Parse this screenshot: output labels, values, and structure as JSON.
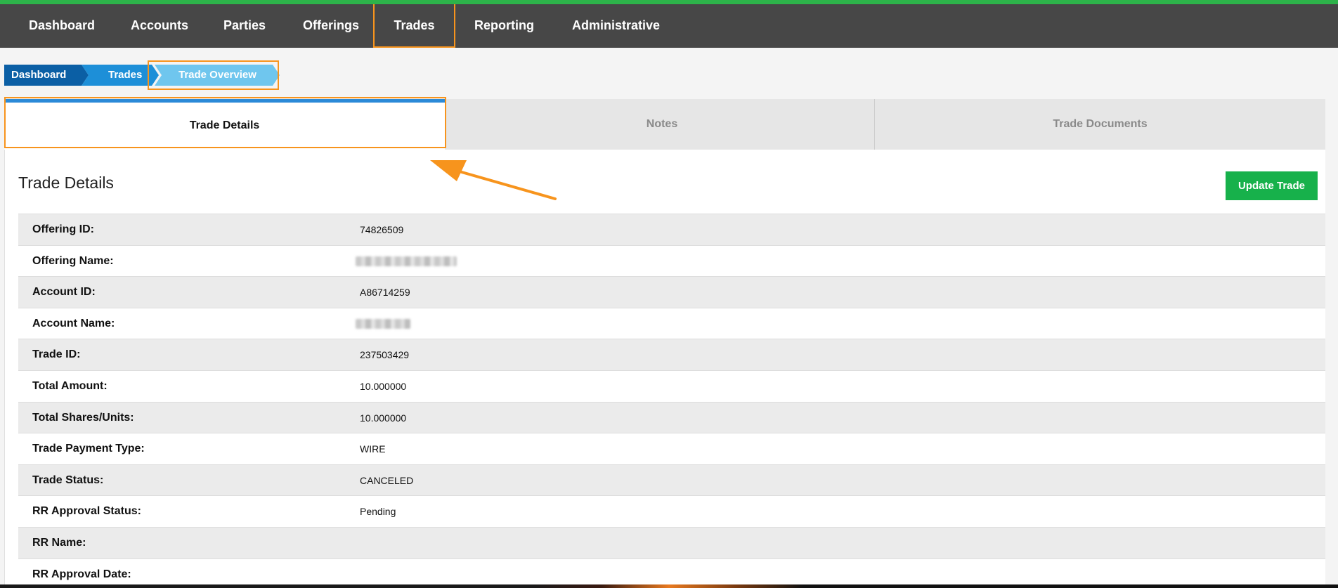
{
  "topnav": {
    "items": [
      "Dashboard",
      "Accounts",
      "Parties",
      "Offerings",
      "Trades",
      "Reporting",
      "Administrative"
    ],
    "active": "Trades"
  },
  "breadcrumb": [
    "Dashboard",
    "Trades",
    "Trade Overview"
  ],
  "tabs": [
    "Trade Details",
    "Notes",
    "Trade Documents"
  ],
  "section": {
    "title": "Trade Details",
    "update_button": "Update Trade"
  },
  "details": [
    {
      "label": "Offering ID:",
      "value": "74826509"
    },
    {
      "label": "Offering Name:",
      "value": ""
    },
    {
      "label": "Account ID:",
      "value": "A86714259"
    },
    {
      "label": "Account Name:",
      "value": ""
    },
    {
      "label": "Trade ID:",
      "value": "237503429"
    },
    {
      "label": "Total Amount:",
      "value": "10.000000"
    },
    {
      "label": "Total Shares/Units:",
      "value": "10.000000"
    },
    {
      "label": "Trade Payment Type:",
      "value": "WIRE"
    },
    {
      "label": "Trade Status:",
      "value": "CANCELED"
    },
    {
      "label": "RR Approval Status:",
      "value": "Pending"
    },
    {
      "label": "RR Name:",
      "value": ""
    },
    {
      "label": "RR Approval Date:",
      "value": ""
    }
  ],
  "colors": {
    "nav_bg": "#474747",
    "accent_green": "#17b14b",
    "highlight_orange": "#f7941d",
    "crumb_dark": "#0b5fa5",
    "crumb_mid": "#1d8fd8",
    "crumb_light": "#6fc6ee",
    "tab_active_border": "#2b8ad8"
  }
}
